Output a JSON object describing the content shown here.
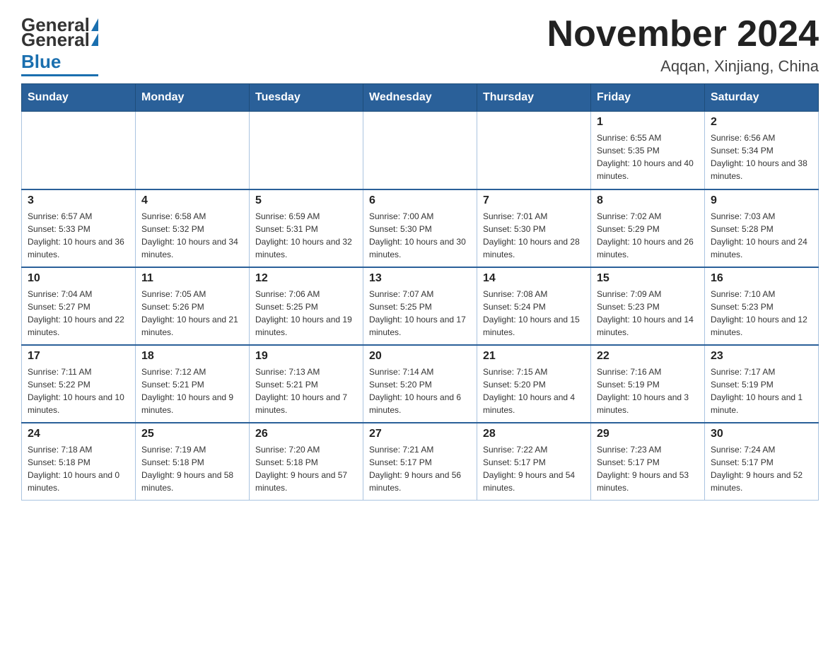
{
  "header": {
    "logo_general": "General",
    "logo_blue": "Blue",
    "month_title": "November 2024",
    "location": "Aqqan, Xinjiang, China"
  },
  "days_of_week": [
    "Sunday",
    "Monday",
    "Tuesday",
    "Wednesday",
    "Thursday",
    "Friday",
    "Saturday"
  ],
  "weeks": [
    [
      {
        "day": "",
        "info": ""
      },
      {
        "day": "",
        "info": ""
      },
      {
        "day": "",
        "info": ""
      },
      {
        "day": "",
        "info": ""
      },
      {
        "day": "",
        "info": ""
      },
      {
        "day": "1",
        "info": "Sunrise: 6:55 AM\nSunset: 5:35 PM\nDaylight: 10 hours and 40 minutes."
      },
      {
        "day": "2",
        "info": "Sunrise: 6:56 AM\nSunset: 5:34 PM\nDaylight: 10 hours and 38 minutes."
      }
    ],
    [
      {
        "day": "3",
        "info": "Sunrise: 6:57 AM\nSunset: 5:33 PM\nDaylight: 10 hours and 36 minutes."
      },
      {
        "day": "4",
        "info": "Sunrise: 6:58 AM\nSunset: 5:32 PM\nDaylight: 10 hours and 34 minutes."
      },
      {
        "day": "5",
        "info": "Sunrise: 6:59 AM\nSunset: 5:31 PM\nDaylight: 10 hours and 32 minutes."
      },
      {
        "day": "6",
        "info": "Sunrise: 7:00 AM\nSunset: 5:30 PM\nDaylight: 10 hours and 30 minutes."
      },
      {
        "day": "7",
        "info": "Sunrise: 7:01 AM\nSunset: 5:30 PM\nDaylight: 10 hours and 28 minutes."
      },
      {
        "day": "8",
        "info": "Sunrise: 7:02 AM\nSunset: 5:29 PM\nDaylight: 10 hours and 26 minutes."
      },
      {
        "day": "9",
        "info": "Sunrise: 7:03 AM\nSunset: 5:28 PM\nDaylight: 10 hours and 24 minutes."
      }
    ],
    [
      {
        "day": "10",
        "info": "Sunrise: 7:04 AM\nSunset: 5:27 PM\nDaylight: 10 hours and 22 minutes."
      },
      {
        "day": "11",
        "info": "Sunrise: 7:05 AM\nSunset: 5:26 PM\nDaylight: 10 hours and 21 minutes."
      },
      {
        "day": "12",
        "info": "Sunrise: 7:06 AM\nSunset: 5:25 PM\nDaylight: 10 hours and 19 minutes."
      },
      {
        "day": "13",
        "info": "Sunrise: 7:07 AM\nSunset: 5:25 PM\nDaylight: 10 hours and 17 minutes."
      },
      {
        "day": "14",
        "info": "Sunrise: 7:08 AM\nSunset: 5:24 PM\nDaylight: 10 hours and 15 minutes."
      },
      {
        "day": "15",
        "info": "Sunrise: 7:09 AM\nSunset: 5:23 PM\nDaylight: 10 hours and 14 minutes."
      },
      {
        "day": "16",
        "info": "Sunrise: 7:10 AM\nSunset: 5:23 PM\nDaylight: 10 hours and 12 minutes."
      }
    ],
    [
      {
        "day": "17",
        "info": "Sunrise: 7:11 AM\nSunset: 5:22 PM\nDaylight: 10 hours and 10 minutes."
      },
      {
        "day": "18",
        "info": "Sunrise: 7:12 AM\nSunset: 5:21 PM\nDaylight: 10 hours and 9 minutes."
      },
      {
        "day": "19",
        "info": "Sunrise: 7:13 AM\nSunset: 5:21 PM\nDaylight: 10 hours and 7 minutes."
      },
      {
        "day": "20",
        "info": "Sunrise: 7:14 AM\nSunset: 5:20 PM\nDaylight: 10 hours and 6 minutes."
      },
      {
        "day": "21",
        "info": "Sunrise: 7:15 AM\nSunset: 5:20 PM\nDaylight: 10 hours and 4 minutes."
      },
      {
        "day": "22",
        "info": "Sunrise: 7:16 AM\nSunset: 5:19 PM\nDaylight: 10 hours and 3 minutes."
      },
      {
        "day": "23",
        "info": "Sunrise: 7:17 AM\nSunset: 5:19 PM\nDaylight: 10 hours and 1 minute."
      }
    ],
    [
      {
        "day": "24",
        "info": "Sunrise: 7:18 AM\nSunset: 5:18 PM\nDaylight: 10 hours and 0 minutes."
      },
      {
        "day": "25",
        "info": "Sunrise: 7:19 AM\nSunset: 5:18 PM\nDaylight: 9 hours and 58 minutes."
      },
      {
        "day": "26",
        "info": "Sunrise: 7:20 AM\nSunset: 5:18 PM\nDaylight: 9 hours and 57 minutes."
      },
      {
        "day": "27",
        "info": "Sunrise: 7:21 AM\nSunset: 5:17 PM\nDaylight: 9 hours and 56 minutes."
      },
      {
        "day": "28",
        "info": "Sunrise: 7:22 AM\nSunset: 5:17 PM\nDaylight: 9 hours and 54 minutes."
      },
      {
        "day": "29",
        "info": "Sunrise: 7:23 AM\nSunset: 5:17 PM\nDaylight: 9 hours and 53 minutes."
      },
      {
        "day": "30",
        "info": "Sunrise: 7:24 AM\nSunset: 5:17 PM\nDaylight: 9 hours and 52 minutes."
      }
    ]
  ]
}
